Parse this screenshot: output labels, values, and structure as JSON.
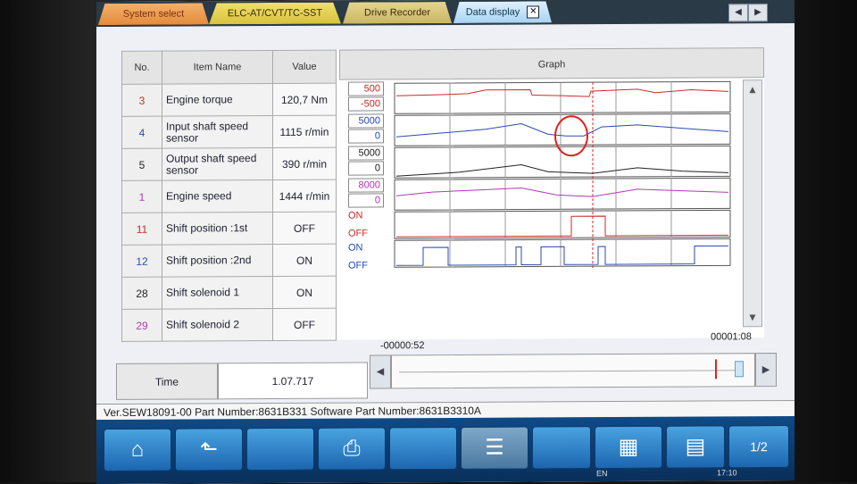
{
  "tabs": [
    {
      "label": "System select"
    },
    {
      "label": "ELC-AT/CVT/TC-SST"
    },
    {
      "label": "Drive Recorder"
    },
    {
      "label": "Data display"
    }
  ],
  "tab_close_glyph": "✕",
  "nav": {
    "prev": "◀",
    "next": "▶"
  },
  "table": {
    "headers": {
      "no": "No.",
      "name": "Item Name",
      "value": "Value",
      "graph": "Graph"
    },
    "rows": [
      {
        "no": "3",
        "name": "Engine torque",
        "value": "120,7 Nm",
        "no_color": "#cc2a2a"
      },
      {
        "no": "4",
        "name": "Input shaft speed sensor",
        "value": "1115 r/min",
        "no_color": "#2a4ab0"
      },
      {
        "no": "5",
        "name": "Output shaft speed sensor",
        "value": "390 r/min",
        "no_color": "#222222"
      },
      {
        "no": "1",
        "name": "Engine speed",
        "value": "1444 r/min",
        "no_color": "#b03ab8"
      },
      {
        "no": "11",
        "name": "Shift position :1st",
        "value": "OFF",
        "no_color": "#cc2a2a"
      },
      {
        "no": "12",
        "name": "Shift position :2nd",
        "value": "ON",
        "no_color": "#2a4ab0"
      },
      {
        "no": "28",
        "name": "Shift solenoid 1",
        "value": "ON",
        "no_color": "#222222"
      },
      {
        "no": "29",
        "name": "Shift solenoid 2",
        "value": "OFF",
        "no_color": "#b03ab8"
      }
    ]
  },
  "graph": {
    "scales": [
      {
        "max": "500",
        "min": "-500",
        "color": "#cc2a2a"
      },
      {
        "max": "5000",
        "min": "0",
        "color": "#2a4ab0"
      },
      {
        "max": "5000",
        "min": "0",
        "color": "#222222"
      },
      {
        "max": "8000",
        "min": "0",
        "color": "#b03ab8"
      }
    ],
    "onoff": [
      {
        "on": "ON",
        "off": "OFF",
        "color": "#cc2a2a"
      },
      {
        "on": "ON",
        "off": "OFF",
        "color": "#2a4ab0"
      }
    ],
    "time_start": "-00000:52",
    "time_end": "00001:08"
  },
  "time": {
    "label": "Time",
    "value": "1.07.717"
  },
  "status": "Ver.SEW18091-00 Part Number:8631B331   Software Part Number:8631B3310A",
  "toolbar": {
    "page": "1/2"
  },
  "taskbar": {
    "lang": "EN",
    "clock": "17:10"
  },
  "colors": {
    "torque": "#cc2a2a",
    "input": "#2a4ab0",
    "output": "#222222",
    "engine": "#b03ab8",
    "highlight": "#e02020"
  }
}
